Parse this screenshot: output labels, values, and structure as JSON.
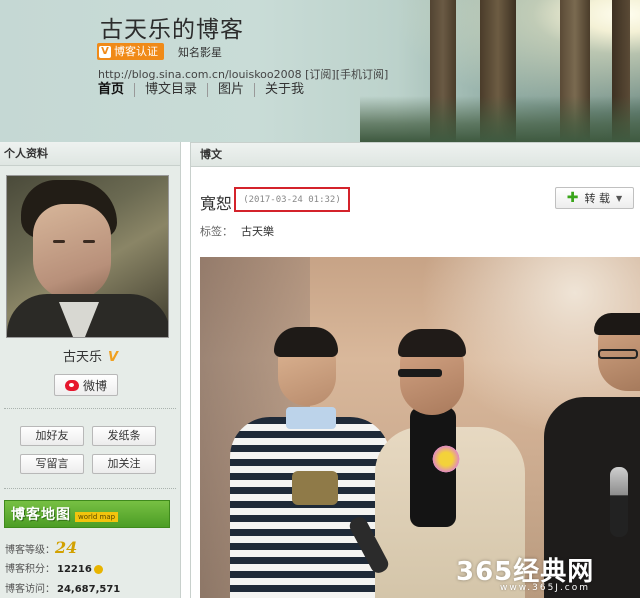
{
  "header": {
    "blog_title": "古天乐的博客",
    "verify_badge": "博客认证",
    "verify_mark": "V",
    "famous_tag": "知名影星",
    "blog_url": "http://blog.sina.com.cn/louiskoo2008  [订阅][手机订阅]",
    "nav": [
      "首页",
      "博文目录",
      "图片",
      "关于我"
    ]
  },
  "sidebar": {
    "section_title": "个人资料",
    "owner_name": "古天乐",
    "owner_v": "V",
    "weibo_button": "微博",
    "actions": [
      "加好友",
      "发纸条",
      "写留言",
      "加关注"
    ],
    "blog_map": {
      "title": "博客地图",
      "subtitle": "world map"
    },
    "stats": {
      "level_label": "博客等级：",
      "level_value": "24",
      "points_label": "博客积分：",
      "points_value": "12216",
      "visits_label": "博客访问：",
      "visits_value": "24,687,571"
    }
  },
  "main": {
    "section_title": "博文",
    "post_title": "寬恕",
    "post_time": "(2017-03-24 01:32)",
    "repost_label": "转 载",
    "tags_label": "标签：",
    "tag": "古天樂",
    "watermark": "365经典网",
    "watermark_sub": "www.365J.com"
  },
  "colors": {
    "highlight_box": "#d4232b",
    "verify_orange": "#f08a18",
    "map_green": "#4c9d25"
  },
  "icons": {
    "weibo": "weibo-icon",
    "repost": "plus-icon",
    "dropdown": "caret-down-icon"
  }
}
